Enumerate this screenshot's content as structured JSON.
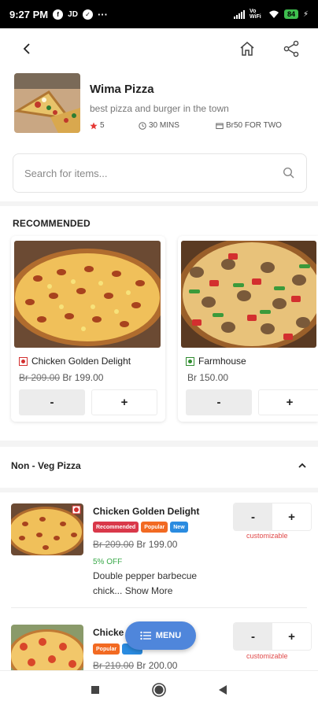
{
  "status_bar": {
    "time": "9:27 PM",
    "icons": [
      "facebook-icon",
      "jd-icon",
      "check-circle-icon",
      "more-dots-icon"
    ],
    "jd_label": "JD",
    "network_label": "Vo WiFi",
    "battery": "84"
  },
  "nav": {
    "icons": [
      "back-arrow-icon",
      "home-icon",
      "share-icon"
    ]
  },
  "restaurant": {
    "name": "Wima Pizza",
    "tagline": "best pizza and burger in the town",
    "rating": "5",
    "time": "30 MINS",
    "cost": "Br50 FOR TWO",
    "star_color": "#e53935"
  },
  "search": {
    "placeholder": "Search for items...",
    "value": ""
  },
  "recommended": {
    "title": "RECOMMENDED",
    "items": [
      {
        "name": "Chicken Golden Delight",
        "old_price": "Br 209.00",
        "price": "Br 199.00",
        "veg": false,
        "minus": "-",
        "plus": "+"
      },
      {
        "name": "Farmhouse",
        "old_price": "",
        "price": "Br 150.00",
        "veg": true,
        "minus": "-",
        "plus": "+"
      }
    ]
  },
  "category": {
    "title": "Non - Veg Pizza",
    "icon": "chevron-up-icon",
    "items": [
      {
        "name": "Chicken Golden Delight",
        "badges": [
          "Recommended",
          "Popular",
          "New"
        ],
        "old_price": "Br 209.00",
        "price": "Br 199.00",
        "off": "5% OFF",
        "desc": "Double pepper barbecue chick...",
        "show_more": "Show More",
        "minus": "-",
        "plus": "+",
        "customizable": "customizable"
      },
      {
        "name": "Chicke",
        "badges": [
          "Popular",
          ""
        ],
        "old_price": "Br 210.00",
        "price": "Br 200.00",
        "minus": "-",
        "plus": "+",
        "customizable": "customizable"
      }
    ]
  },
  "fab": {
    "label": "MENU",
    "icon": "menu-list-icon"
  },
  "colors": {
    "accent": "#4f86db",
    "badge_recommended": "#d9384a",
    "badge_popular": "#f26a22",
    "badge_new": "#2a8be0",
    "offer_green": "#3aa94a",
    "customizable_red": "#e04a4a",
    "non_veg": "#d32f2f",
    "veg": "#2e8b2e"
  },
  "android_nav": {
    "icons": [
      "recents-square-icon",
      "home-circle-icon",
      "back-triangle-icon"
    ]
  }
}
